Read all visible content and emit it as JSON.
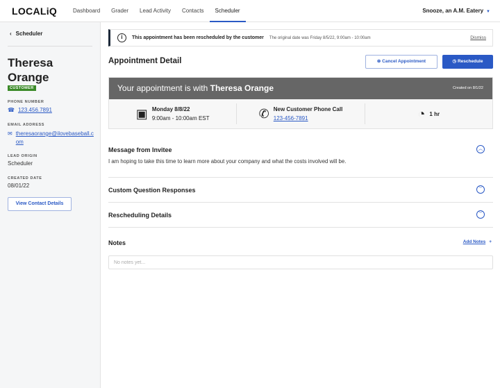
{
  "header": {
    "logo": "LOCALiQ",
    "nav": [
      "Dashboard",
      "Grader",
      "Lead Activity",
      "Contacts",
      "Scheduler"
    ],
    "active": "Scheduler",
    "account": "Snooze, an A.M. Eatery"
  },
  "sidebar": {
    "back": "Scheduler",
    "name": "Theresa Orange",
    "badge": "CUSTOMER",
    "phone_label": "PHONE NUMBER",
    "phone": "123.456.7891",
    "email_label": "EMAIL ADDRESS",
    "email": "theresaorange@ilovebaseball.com",
    "origin_label": "LEAD ORIGIN",
    "origin": "Scheduler",
    "created_label": "CREATED DATE",
    "created": "08/01/22",
    "view_button": "View Contact Details"
  },
  "banner": {
    "title": "This appointment has been rescheduled by the customer",
    "detail": "The original date was Friday 8/5/22, 9:00am - 10:00am",
    "dismiss": "Dismiss"
  },
  "main": {
    "title": "Appointment Detail",
    "cancel": "Cancel Appointment",
    "reschedule": "Reschedule",
    "card": {
      "prefix": "Your appointment is with ",
      "name": "Theresa Orange",
      "created": "Created on 8/1/22",
      "date": "Monday 8/8/22",
      "time": "9:00am - 10:00am EST",
      "type": "New Customer Phone Call",
      "phone": "123-456-7891",
      "duration": "1 hr"
    },
    "sections": [
      {
        "title": "Message from Invitee",
        "body": "I am hoping to take this time to learn more about your company and what the costs involved will be."
      },
      {
        "title": "Custom Question Responses"
      },
      {
        "title": "Rescheduling Details"
      }
    ],
    "notes": {
      "title": "Notes",
      "add": "Add Notes",
      "placeholder": "No notes yet..."
    }
  },
  "colors": {
    "accent": "#2a59c5",
    "badge": "#3b8a28",
    "card_header": "#666666"
  }
}
